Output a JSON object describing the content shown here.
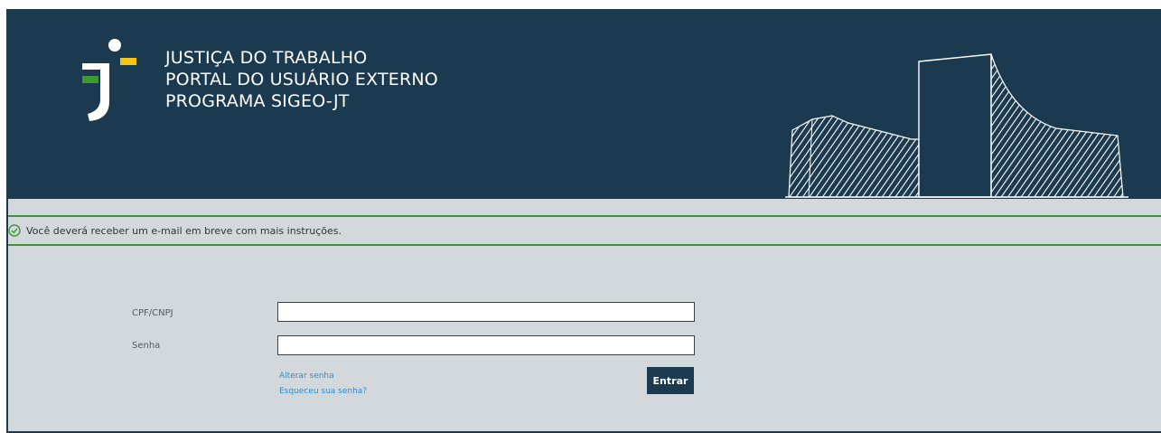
{
  "header": {
    "title_lines": [
      "JUSTIÇA DO TRABALHO",
      "PORTAL DO USUÁRIO EXTERNO",
      "PROGRAMA SIGEO-JT"
    ],
    "logo_icon": "jt-logo-icon",
    "illustration": "court-building-illustration"
  },
  "alert": {
    "icon": "check-circle-icon",
    "message": "Você deverá receber um e-mail em breve com mais instruções.",
    "color": "#3d9a2e"
  },
  "form": {
    "cpf_label": "CPF/CNPJ",
    "cpf_value": "",
    "password_label": "Senha",
    "password_value": "",
    "change_password_link": "Alterar senha",
    "forgot_password_link": "Esqueceu sua senha?",
    "submit_label": "Entrar"
  },
  "colors": {
    "brand_dark": "#1b3a50",
    "background": "#d3d8dc",
    "link": "#2d8ec9",
    "logo_green": "#3d9a2e",
    "logo_yellow": "#f5c518"
  }
}
